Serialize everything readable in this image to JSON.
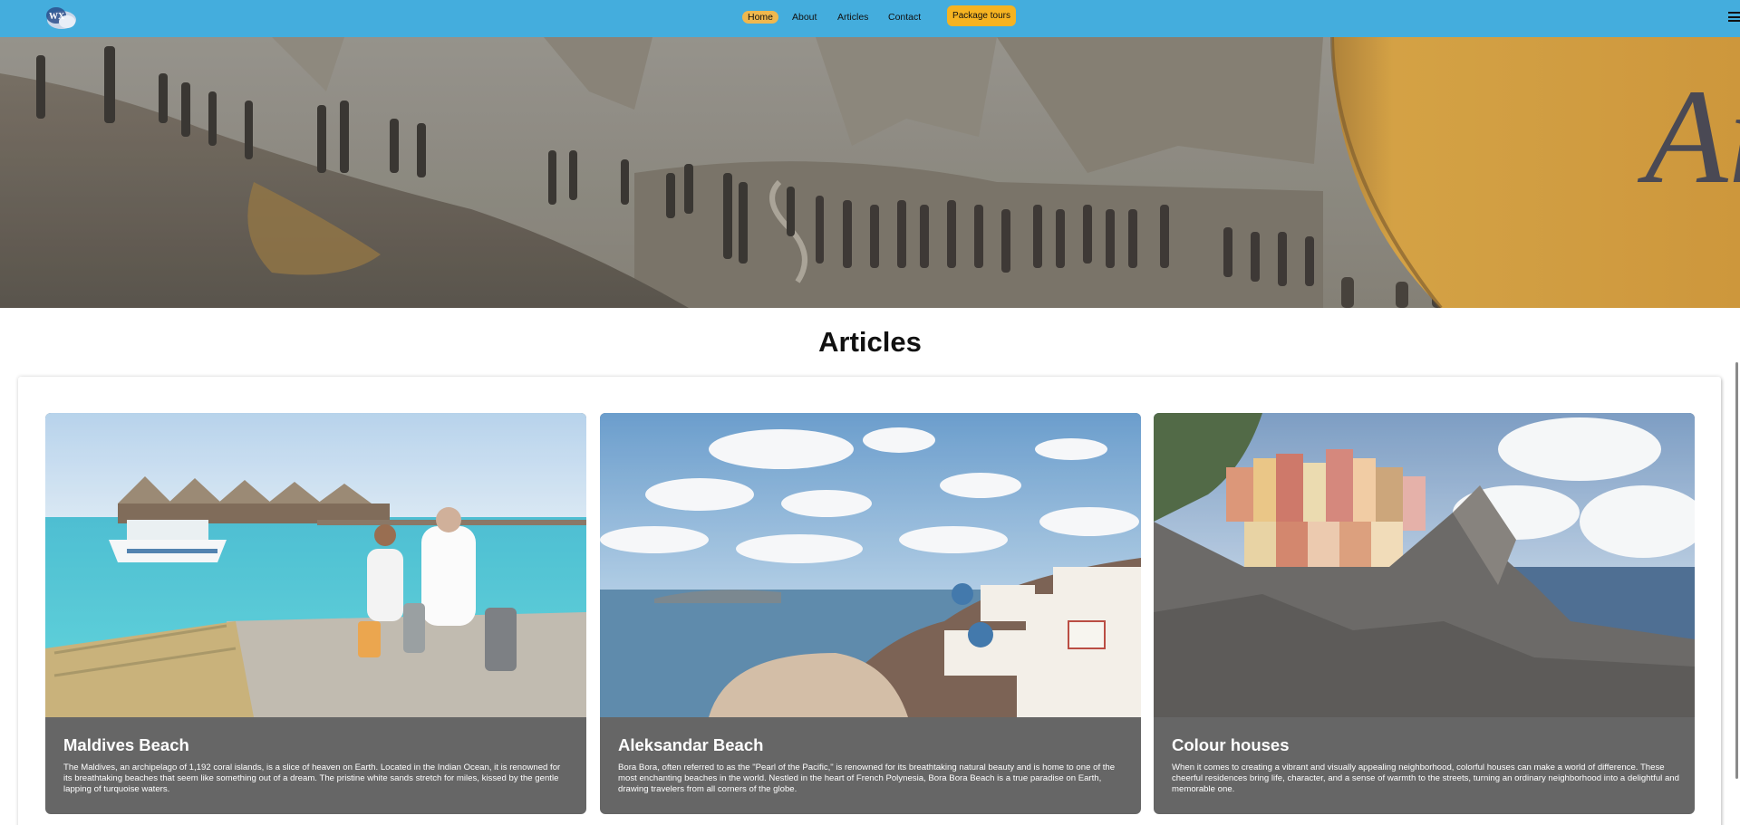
{
  "nav": {
    "logo_text": "WX",
    "links": [
      "Home",
      "About",
      "Articles",
      "Contact"
    ],
    "active": "Home",
    "package_button": "Package tours"
  },
  "hero": {
    "balloon_text": "Ar"
  },
  "articles": {
    "heading": "Articles",
    "cards": [
      {
        "title": "Maldives Beach",
        "text": "The Maldives, an archipelago of 1,192 coral islands, is a slice of heaven on Earth. Located in the Indian Ocean, it is renowned for its breathtaking beaches that seem like something out of a dream. The pristine white sands stretch for miles, kissed by the gentle lapping of turquoise waters."
      },
      {
        "title": "Aleksandar Beach",
        "text": "Bora Bora, often referred to as the \"Pearl of the Pacific,\" is renowned for its breathtaking natural beauty and is home to one of the most enchanting beaches in the world. Nestled in the heart of French Polynesia, Bora Bora Beach is a true paradise on Earth, drawing travelers from all corners of the globe."
      },
      {
        "title": "Colour houses",
        "text": "When it comes to creating a vibrant and visually appealing neighborhood, colorful houses can make a world of difference. These cheerful residences bring life, character, and a sense of warmth to the streets, turning an ordinary neighborhood into a delightful and memorable one."
      }
    ]
  },
  "colors": {
    "navbar": "#44addd",
    "accent": "#f6b321",
    "card_body": "#666666"
  }
}
